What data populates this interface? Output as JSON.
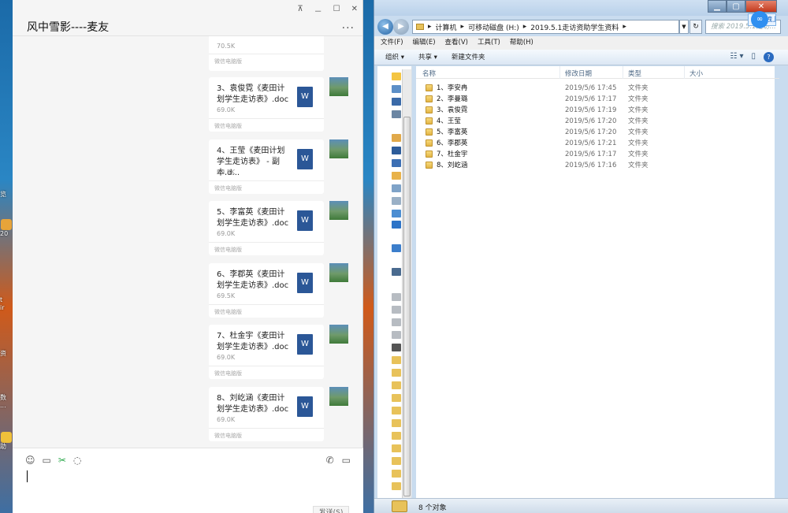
{
  "desktop": {
    "labels": [
      "览",
      "20",
      "t",
      "ir",
      "资",
      "数",
      "...",
      "助"
    ]
  },
  "chat": {
    "title": "风中雪影----麦友",
    "window_controls": [
      "⊼",
      "－",
      "☐",
      "✕"
    ],
    "more": "···",
    "first_partial": {
      "size": "70.5K",
      "source": "微信电脑版"
    },
    "files": [
      {
        "title": "3、袁俊霓《麦田计划学生走访表》.doc",
        "size": "69.0K",
        "source": "微信电脑版",
        "icon": "W"
      },
      {
        "title": "4、王莹《麦田计划学生走访表》 - 副本.d...",
        "size": "69.5K",
        "source": "微信电脑版",
        "icon": "W"
      },
      {
        "title": "5、李富英《麦田计划学生走访表》.doc",
        "size": "69.0K",
        "source": "微信电脑版",
        "icon": "W"
      },
      {
        "title": "6、李郡英《麦田计划学生走访表》.doc",
        "size": "69.5K",
        "source": "微信电脑版",
        "icon": "W"
      },
      {
        "title": "7、杜金宇《麦田计划学生走访表》.doc",
        "size": "69.0K",
        "source": "微信电脑版",
        "icon": "W"
      },
      {
        "title": "8、刘屹涵《麦田计划学生走访表》.doc",
        "size": "69.0K",
        "source": "微信电脑版",
        "icon": "W"
      }
    ],
    "toolbar": {
      "emoji": "☺",
      "folder": "▭",
      "scissors": "✂",
      "chat": "◌",
      "phone": "✆",
      "video": "▭"
    },
    "send_label": "发送(S)"
  },
  "explorer": {
    "caption": {
      "minimize": "▁",
      "maximize": "▢",
      "close": "✕"
    },
    "nav": {
      "back": "◀",
      "forward": "▶"
    },
    "breadcrumb": [
      "▸",
      "计算机",
      "▸",
      "可移动磁盘 (H:)",
      "▸",
      "2019.5.1走访资助学生资料",
      "▸"
    ],
    "address_dropdown": "▼",
    "address_refresh": "↻",
    "search_placeholder": "搜索 2019.5.1走访...",
    "baidu_badge": "拖拽上传",
    "baidu_logo": "∞",
    "menu": [
      "文件(F)",
      "编辑(E)",
      "查看(V)",
      "工具(T)",
      "帮助(H)"
    ],
    "commands": [
      "组织 ▾",
      "共享 ▾",
      "新建文件夹"
    ],
    "view_icons": [
      "☷ ▾",
      "▯"
    ],
    "help": "?",
    "columns": {
      "name": "名称",
      "date": "修改日期",
      "type": "类型",
      "size": "大小"
    },
    "files": [
      {
        "name": "1、李安冉",
        "date": "2019/5/6 17:45",
        "type": "文件夹"
      },
      {
        "name": "2、李曼璐",
        "date": "2019/5/6 17:17",
        "type": "文件夹"
      },
      {
        "name": "3、袁俊霓",
        "date": "2019/5/6 17:19",
        "type": "文件夹"
      },
      {
        "name": "4、王莹",
        "date": "2019/5/6 17:20",
        "type": "文件夹"
      },
      {
        "name": "5、李富英",
        "date": "2019/5/6 17:20",
        "type": "文件夹"
      },
      {
        "name": "6、李郡英",
        "date": "2019/5/6 17:21",
        "type": "文件夹"
      },
      {
        "name": "7、杜金宇",
        "date": "2019/5/6 17:17",
        "type": "文件夹"
      },
      {
        "name": "8、刘屹涵",
        "date": "2019/5/6 17:16",
        "type": "文件夹"
      }
    ],
    "status": "8 个对象"
  }
}
